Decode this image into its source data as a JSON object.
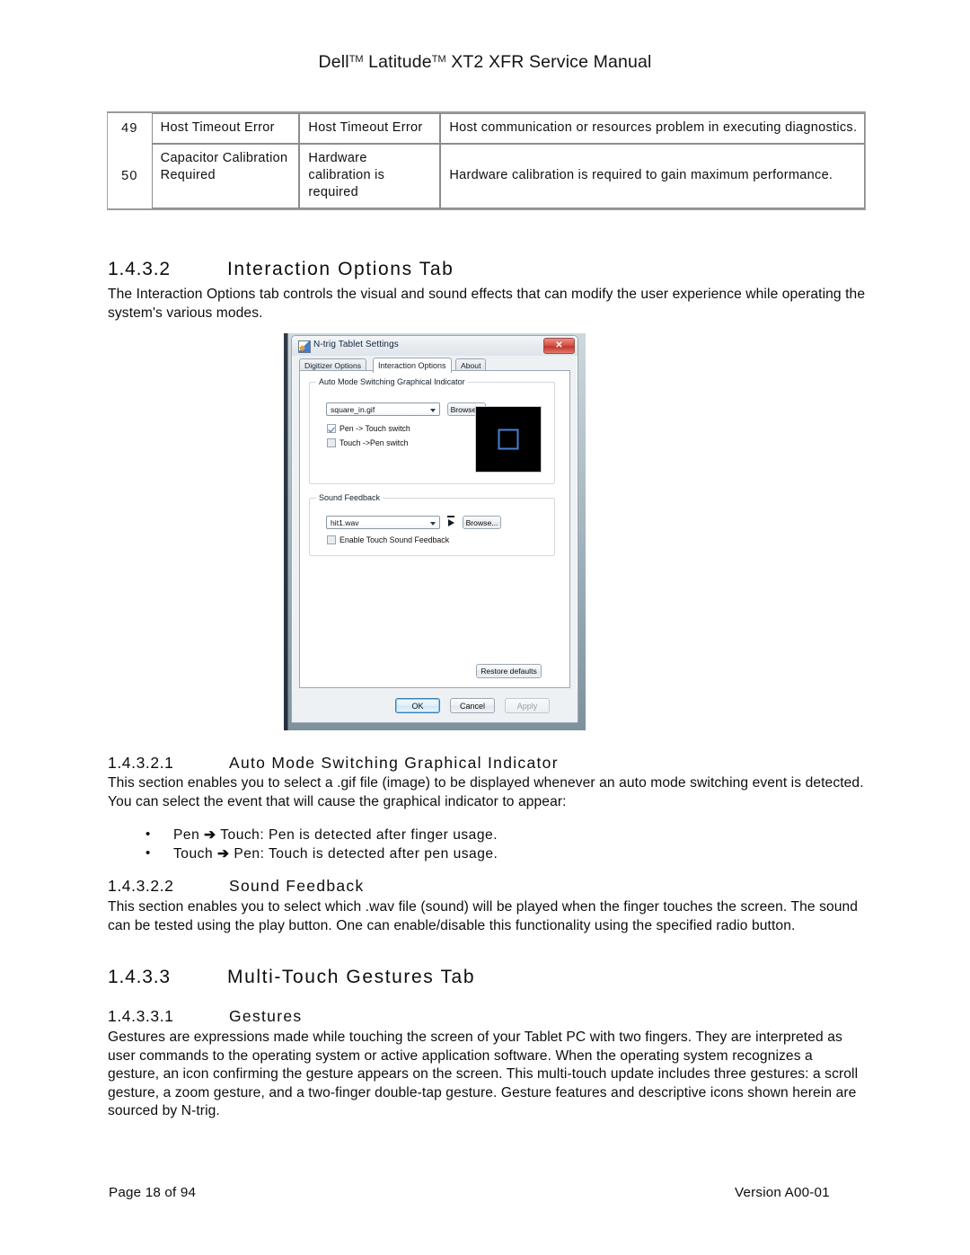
{
  "header": {
    "title_part1": "Dell",
    "tm1": "TM",
    "title_part2": " Latitude",
    "tm2": "TM",
    "title_part3": " XT2 XFR Service Manual"
  },
  "error_table": {
    "rows": [
      {
        "id": "49",
        "name": "Host Timeout Error",
        "message": "Host Timeout Error",
        "description": "Host communication or resources problem in executing diagnostics."
      },
      {
        "id": "50",
        "name": "Capacitor Calibration Required",
        "message": "Hardware calibration is required",
        "description": "Hardware calibration is required to gain maximum performance."
      }
    ]
  },
  "sections": {
    "s1432": {
      "number": "1.4.3.2",
      "title": "Interaction Options Tab",
      "body": "The Interaction Options tab controls the visual and sound effects that can modify the user experience while operating the system's various modes."
    },
    "s14321": {
      "number": "1.4.3.2.1",
      "title": "Auto Mode Switching Graphical Indicator",
      "body": "This section enables you to select a .gif file (image) to be displayed whenever an auto mode switching event is detected. You can select the event that will cause the graphical indicator to appear:",
      "bullets": [
        {
          "left": "Pen ",
          "arrow": "➔",
          "right": " Touch: Pen is detected after finger usage."
        },
        {
          "left": "Touch ",
          "arrow": "➔",
          "right": " Pen: Touch is detected after pen usage."
        }
      ]
    },
    "s14322": {
      "number": "1.4.3.2.2",
      "title": "Sound Feedback",
      "body": "This section enables you to select which .wav file (sound) will be played when the finger touches the screen. The sound can be tested using the play button. One can enable/disable this functionality using the specified radio button."
    },
    "s1433": {
      "number": "1.4.3.3",
      "title": "Multi-Touch Gestures Tab"
    },
    "s14331": {
      "number": "1.4.3.3.1",
      "title": "Gestures",
      "body": "Gestures are expressions made while touching the screen of your Tablet PC with two fingers. They are interpreted as user commands to the operating system or active application software. When the operating system recognizes a gesture, an icon confirming the gesture appears on the screen. This multi-touch update includes three gestures: a scroll gesture, a zoom gesture, and a two-finger double-tap gesture. Gesture features and descriptive icons shown herein are sourced by N-trig."
    }
  },
  "dialog": {
    "title": "N-trig Tablet Settings",
    "close_label": "✕",
    "tabs": [
      {
        "label": "Digitizer Options",
        "active": false
      },
      {
        "label": "Interaction Options",
        "active": true
      },
      {
        "label": "About",
        "active": false
      }
    ],
    "auto_mode_group": {
      "legend": "Auto Mode Switching Graphical Indicator",
      "gif_value": "square_in.gif",
      "browse_label": "Browse...",
      "checkbox_pen_to_touch": "Pen -> Touch switch",
      "checkbox_touch_to_pen": "Touch ->Pen switch"
    },
    "sound_group": {
      "legend": "Sound Feedback",
      "wav_value": "hit1.wav",
      "browse_label": "Browse...",
      "checkbox_enable": "Enable Touch Sound Feedback"
    },
    "restore_label": "Restore defaults",
    "ok_label": "OK",
    "cancel_label": "Cancel",
    "apply_label": "Apply",
    "colors": {
      "preview_background": "#000000",
      "preview_square": "#4a7fd4",
      "close_button": "#c3362c",
      "ok_border": "#3c7fb1"
    }
  },
  "footer": {
    "page": "Page 18 of 94",
    "version": "Version A00-01"
  }
}
